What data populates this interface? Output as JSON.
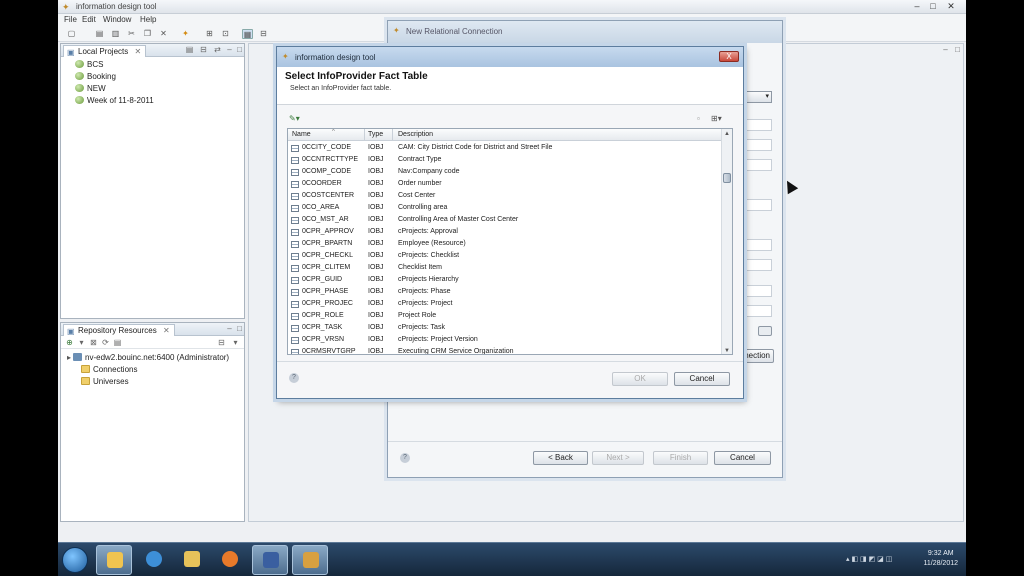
{
  "ide": {
    "title": "information design tool",
    "menus": [
      "File",
      "Edit",
      "Window",
      "Help"
    ]
  },
  "local_projects": {
    "tab_label": "Local Projects",
    "items": [
      "BCS",
      "Booking",
      "NEW",
      "Week of 11-8-2011"
    ]
  },
  "repository": {
    "tab_label": "Repository Resources",
    "server": "nv-edw2.bouinc.net:6400 (Administrator)",
    "children": [
      "Connections",
      "Universes"
    ]
  },
  "wizard": {
    "title": "New Relational Connection",
    "back_label": "< Back",
    "next_label": "Next >",
    "finish_label": "Finish",
    "cancel_label": "Cancel",
    "partial_button": "nection"
  },
  "dialog": {
    "title": "information design tool",
    "close_label": "X",
    "heading": "Select InfoProvider Fact Table",
    "subtitle": "Select an InfoProvider fact table.",
    "columns": {
      "name": "Name",
      "type": "Type",
      "description": "Description"
    },
    "rows": [
      {
        "name": "0CCITY_CODE",
        "type": "IOBJ",
        "description": "CAM: City District Code for District and Street File"
      },
      {
        "name": "0CCNTRCTTYPE",
        "type": "IOBJ",
        "description": "Contract Type"
      },
      {
        "name": "0COMP_CODE",
        "type": "IOBJ",
        "description": "Nav:Company code"
      },
      {
        "name": "0COORDER",
        "type": "IOBJ",
        "description": "Order number"
      },
      {
        "name": "0COSTCENTER",
        "type": "IOBJ",
        "description": "Cost Center"
      },
      {
        "name": "0CO_AREA",
        "type": "IOBJ",
        "description": "Controlling area"
      },
      {
        "name": "0CO_MST_AR",
        "type": "IOBJ",
        "description": "Controlling Area of Master Cost Center"
      },
      {
        "name": "0CPR_APPROV",
        "type": "IOBJ",
        "description": "cProjects: Approval"
      },
      {
        "name": "0CPR_BPARTN",
        "type": "IOBJ",
        "description": "Employee (Resource)"
      },
      {
        "name": "0CPR_CHECKL",
        "type": "IOBJ",
        "description": "cProjects: Checklist"
      },
      {
        "name": "0CPR_CLITEM",
        "type": "IOBJ",
        "description": "Checklist Item"
      },
      {
        "name": "0CPR_GUID",
        "type": "IOBJ",
        "description": "cProjects Hierarchy"
      },
      {
        "name": "0CPR_PHASE",
        "type": "IOBJ",
        "description": "cProjects: Phase"
      },
      {
        "name": "0CPR_PROJEC",
        "type": "IOBJ",
        "description": "cProjects: Project"
      },
      {
        "name": "0CPR_ROLE",
        "type": "IOBJ",
        "description": "Project Role"
      },
      {
        "name": "0CPR_TASK",
        "type": "IOBJ",
        "description": "cProjects: Task"
      },
      {
        "name": "0CPR_VRSN",
        "type": "IOBJ",
        "description": "cProjects: Project Version"
      },
      {
        "name": "0CRMSRVTGRP",
        "type": "IOBJ",
        "description": "Executing CRM Service Organization"
      }
    ],
    "ok_label": "OK",
    "cancel_label": "Cancel"
  },
  "taskbar": {
    "time": "9:32 AM",
    "date": "11/28/2012"
  },
  "colors": {
    "dialog_titlebar": "#a9c3e0",
    "taskbar": "#15273b",
    "close_button": "#c9483a"
  }
}
